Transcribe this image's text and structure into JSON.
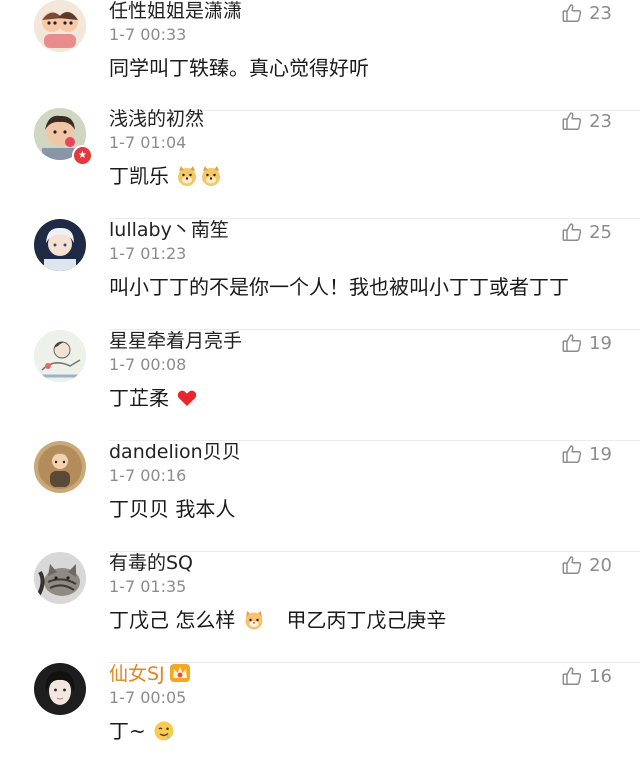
{
  "comments": [
    {
      "username": "任性姐姐是潇潇",
      "time": "1-7 00:33",
      "text": "同学叫丁轶臻。真心觉得好听",
      "likes": "23",
      "avatar_icon": "cartoon-couple-avatar",
      "username_color": "#222222"
    },
    {
      "username": "浅浅的初然",
      "time": "1-7 01:04",
      "text": "丁凯乐",
      "likes": "23",
      "avatar_icon": "boy-lollipop-avatar",
      "badge_icon": "vip-star-badge-icon",
      "badge": "★",
      "emoji": [
        "doge-emoji-icon",
        "doge-emoji-icon"
      ]
    },
    {
      "username": "lullaby丶南笙",
      "time": "1-7 01:23",
      "text": "叫小丁丁的不是你一个人！我也被叫小丁丁或者丁丁",
      "likes": "25",
      "avatar_icon": "anime-boy-avatar"
    },
    {
      "username": "星星牵着月亮手",
      "time": "1-7 00:08",
      "text": "丁芷柔",
      "likes": "19",
      "avatar_icon": "sketch-girl-avatar",
      "emoji": [
        "red-heart-icon"
      ]
    },
    {
      "username": "dandelion贝贝",
      "time": "1-7 00:16",
      "text": "丁贝贝 我本人",
      "likes": "19",
      "avatar_icon": "vintage-figure-avatar"
    },
    {
      "username": "有毒的SQ",
      "time": "1-7 01:35",
      "text": "丁戊己 怎么样",
      "text_after": "甲乙丙丁戊己庚辛",
      "likes": "20",
      "avatar_icon": "tabby-cat-avatar",
      "emoji": [
        "cat-face-emoji-icon"
      ]
    },
    {
      "username": "仙女SJ",
      "time": "1-7 00:05",
      "text": "丁~",
      "likes": "16",
      "avatar_icon": "girl-portrait-avatar",
      "username_color": "#e2851e",
      "badge_icon": "crown-vip-icon",
      "emoji": [
        "drooling-face-emoji-icon"
      ]
    }
  ]
}
